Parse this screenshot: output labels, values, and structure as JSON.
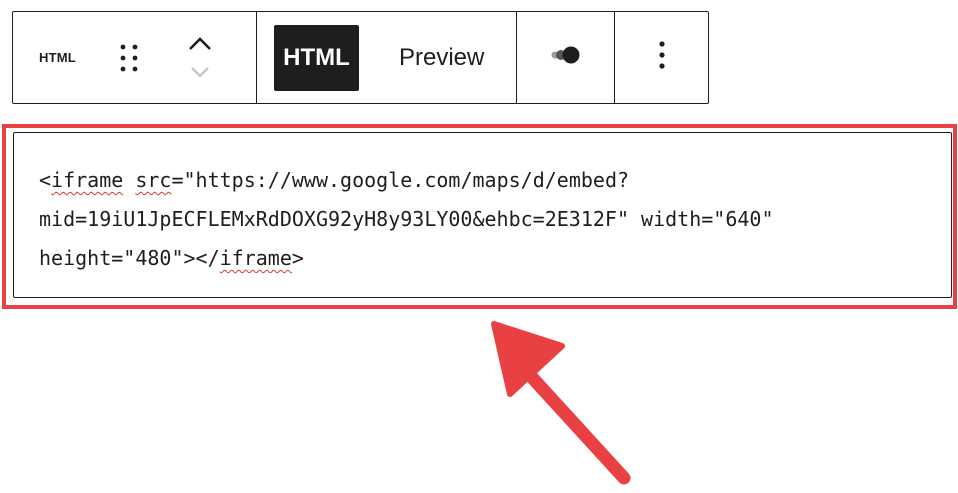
{
  "toolbar": {
    "block_type_label": "HTML",
    "tabs": [
      {
        "label": "HTML",
        "active": true
      },
      {
        "label": "Preview",
        "active": false
      }
    ],
    "icons": {
      "drag": "drag-handle-icon",
      "move_up": "chevron-up-icon",
      "move_down": "chevron-down-icon",
      "toggle": "toggle-icon",
      "options": "more-vertical-icon"
    }
  },
  "editor": {
    "code": {
      "lt": "<",
      "tag_open": "iframe",
      "space": " ",
      "attr_src": "src",
      "after_src": "=\"https://www.google.com/maps/d/embed?mid=19iU1JpECFLEMxRdDOXG92yH8y93LY00&ehbc=2E312F\" width=\"640\" height=\"480\"></",
      "tag_close": "iframe",
      "gt": ">"
    }
  },
  "colors": {
    "highlight": "#e94043",
    "dark": "#1e1e1e",
    "spellcheck": "#d43838"
  }
}
